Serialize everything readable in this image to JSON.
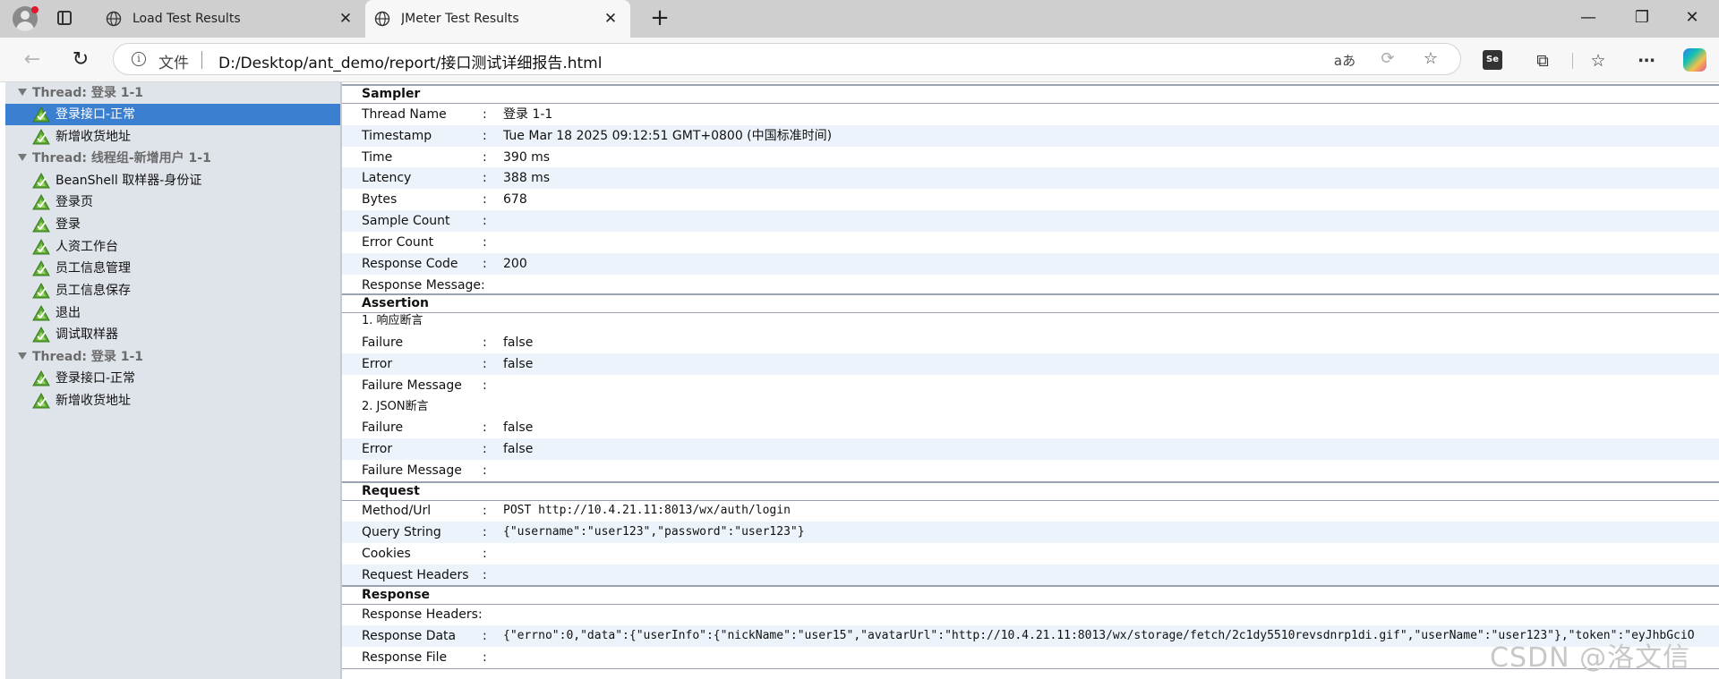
{
  "browser": {
    "tabs": [
      {
        "title": "Load Test Results",
        "active": false
      },
      {
        "title": "JMeter Test Results",
        "active": true
      }
    ],
    "address": {
      "scheme_label": "文件",
      "url": "D:/Desktop/ant_demo/report/接口测试详细报告.html"
    },
    "toolbar_icons": [
      "read-aloud-icon",
      "refresh-circle-icon",
      "favorite-star-icon",
      "selenium-extension-icon",
      "extensions-icon",
      "favorites-icon",
      "more-icon",
      "copilot-icon"
    ],
    "accent_color": "#3b7fd0"
  },
  "tree": {
    "rows": [
      {
        "kind": "thread",
        "label": "Thread: 登录 1-1"
      },
      {
        "kind": "sample",
        "label": "登录接口-正常",
        "selected": true
      },
      {
        "kind": "sample",
        "label": "新增收货地址"
      },
      {
        "kind": "thread",
        "label": "Thread: 线程组-新增用户 1-1"
      },
      {
        "kind": "sample",
        "label": "BeanShell 取样器-身份证"
      },
      {
        "kind": "sample",
        "label": "登录页"
      },
      {
        "kind": "sample",
        "label": "登录"
      },
      {
        "kind": "sample",
        "label": "人资工作台"
      },
      {
        "kind": "sample",
        "label": "员工信息管理"
      },
      {
        "kind": "sample",
        "label": "员工信息保存"
      },
      {
        "kind": "sample",
        "label": "退出"
      },
      {
        "kind": "sample",
        "label": "调试取样器"
      },
      {
        "kind": "thread",
        "label": "Thread: 登录 1-1"
      },
      {
        "kind": "sample",
        "label": "登录接口-正常"
      },
      {
        "kind": "sample",
        "label": "新增收货地址"
      }
    ]
  },
  "details": {
    "colon": ":",
    "sampler": {
      "title": "Sampler",
      "rows": [
        {
          "key": "Thread Name",
          "value": "登录 1-1"
        },
        {
          "key": "Timestamp",
          "value": "Tue Mar 18 2025 09:12:51 GMT+0800 (中国标准时间)"
        },
        {
          "key": "Time",
          "value": "390 ms"
        },
        {
          "key": "Latency",
          "value": "388 ms"
        },
        {
          "key": "Bytes",
          "value": "678"
        },
        {
          "key": "Sample Count",
          "value": ""
        },
        {
          "key": "Error Count",
          "value": ""
        },
        {
          "key": "Response Code",
          "value": "200"
        },
        {
          "key": "Response Message:",
          "value": ""
        }
      ]
    },
    "assertion": {
      "title": "Assertion",
      "groups": [
        {
          "name": "1. 响应断言",
          "rows": [
            {
              "key": "Failure",
              "value": "false"
            },
            {
              "key": "Error",
              "value": "false"
            },
            {
              "key": "Failure Message",
              "value": ""
            }
          ]
        },
        {
          "name": "2. JSON断言",
          "rows": [
            {
              "key": "Failure",
              "value": "false"
            },
            {
              "key": "Error",
              "value": "false"
            },
            {
              "key": "Failure Message",
              "value": ""
            }
          ]
        }
      ]
    },
    "request": {
      "title": "Request",
      "rows": [
        {
          "key": "Method/Url",
          "value": "POST http://10.4.21.11:8013/wx/auth/login"
        },
        {
          "key": "Query String",
          "value": "{\"username\":\"user123\",\"password\":\"user123\"}"
        },
        {
          "key": "Cookies",
          "value": ""
        },
        {
          "key": "Request Headers",
          "value": ""
        }
      ]
    },
    "response": {
      "title": "Response",
      "rows": [
        {
          "key": "Response Headers:",
          "value": ""
        },
        {
          "key": "Response Data",
          "value": "{\"errno\":0,\"data\":{\"userInfo\":{\"nickName\":\"user15\",\"avatarUrl\":\"http://10.4.21.11:8013/wx/storage/fetch/2c1dy5510revsdnrp1di.gif\",\"userName\":\"user123\"},\"token\":\"eyJhbGciO"
        },
        {
          "key": "Response File",
          "value": ""
        }
      ]
    }
  },
  "watermark": "CSDN @洛文信"
}
